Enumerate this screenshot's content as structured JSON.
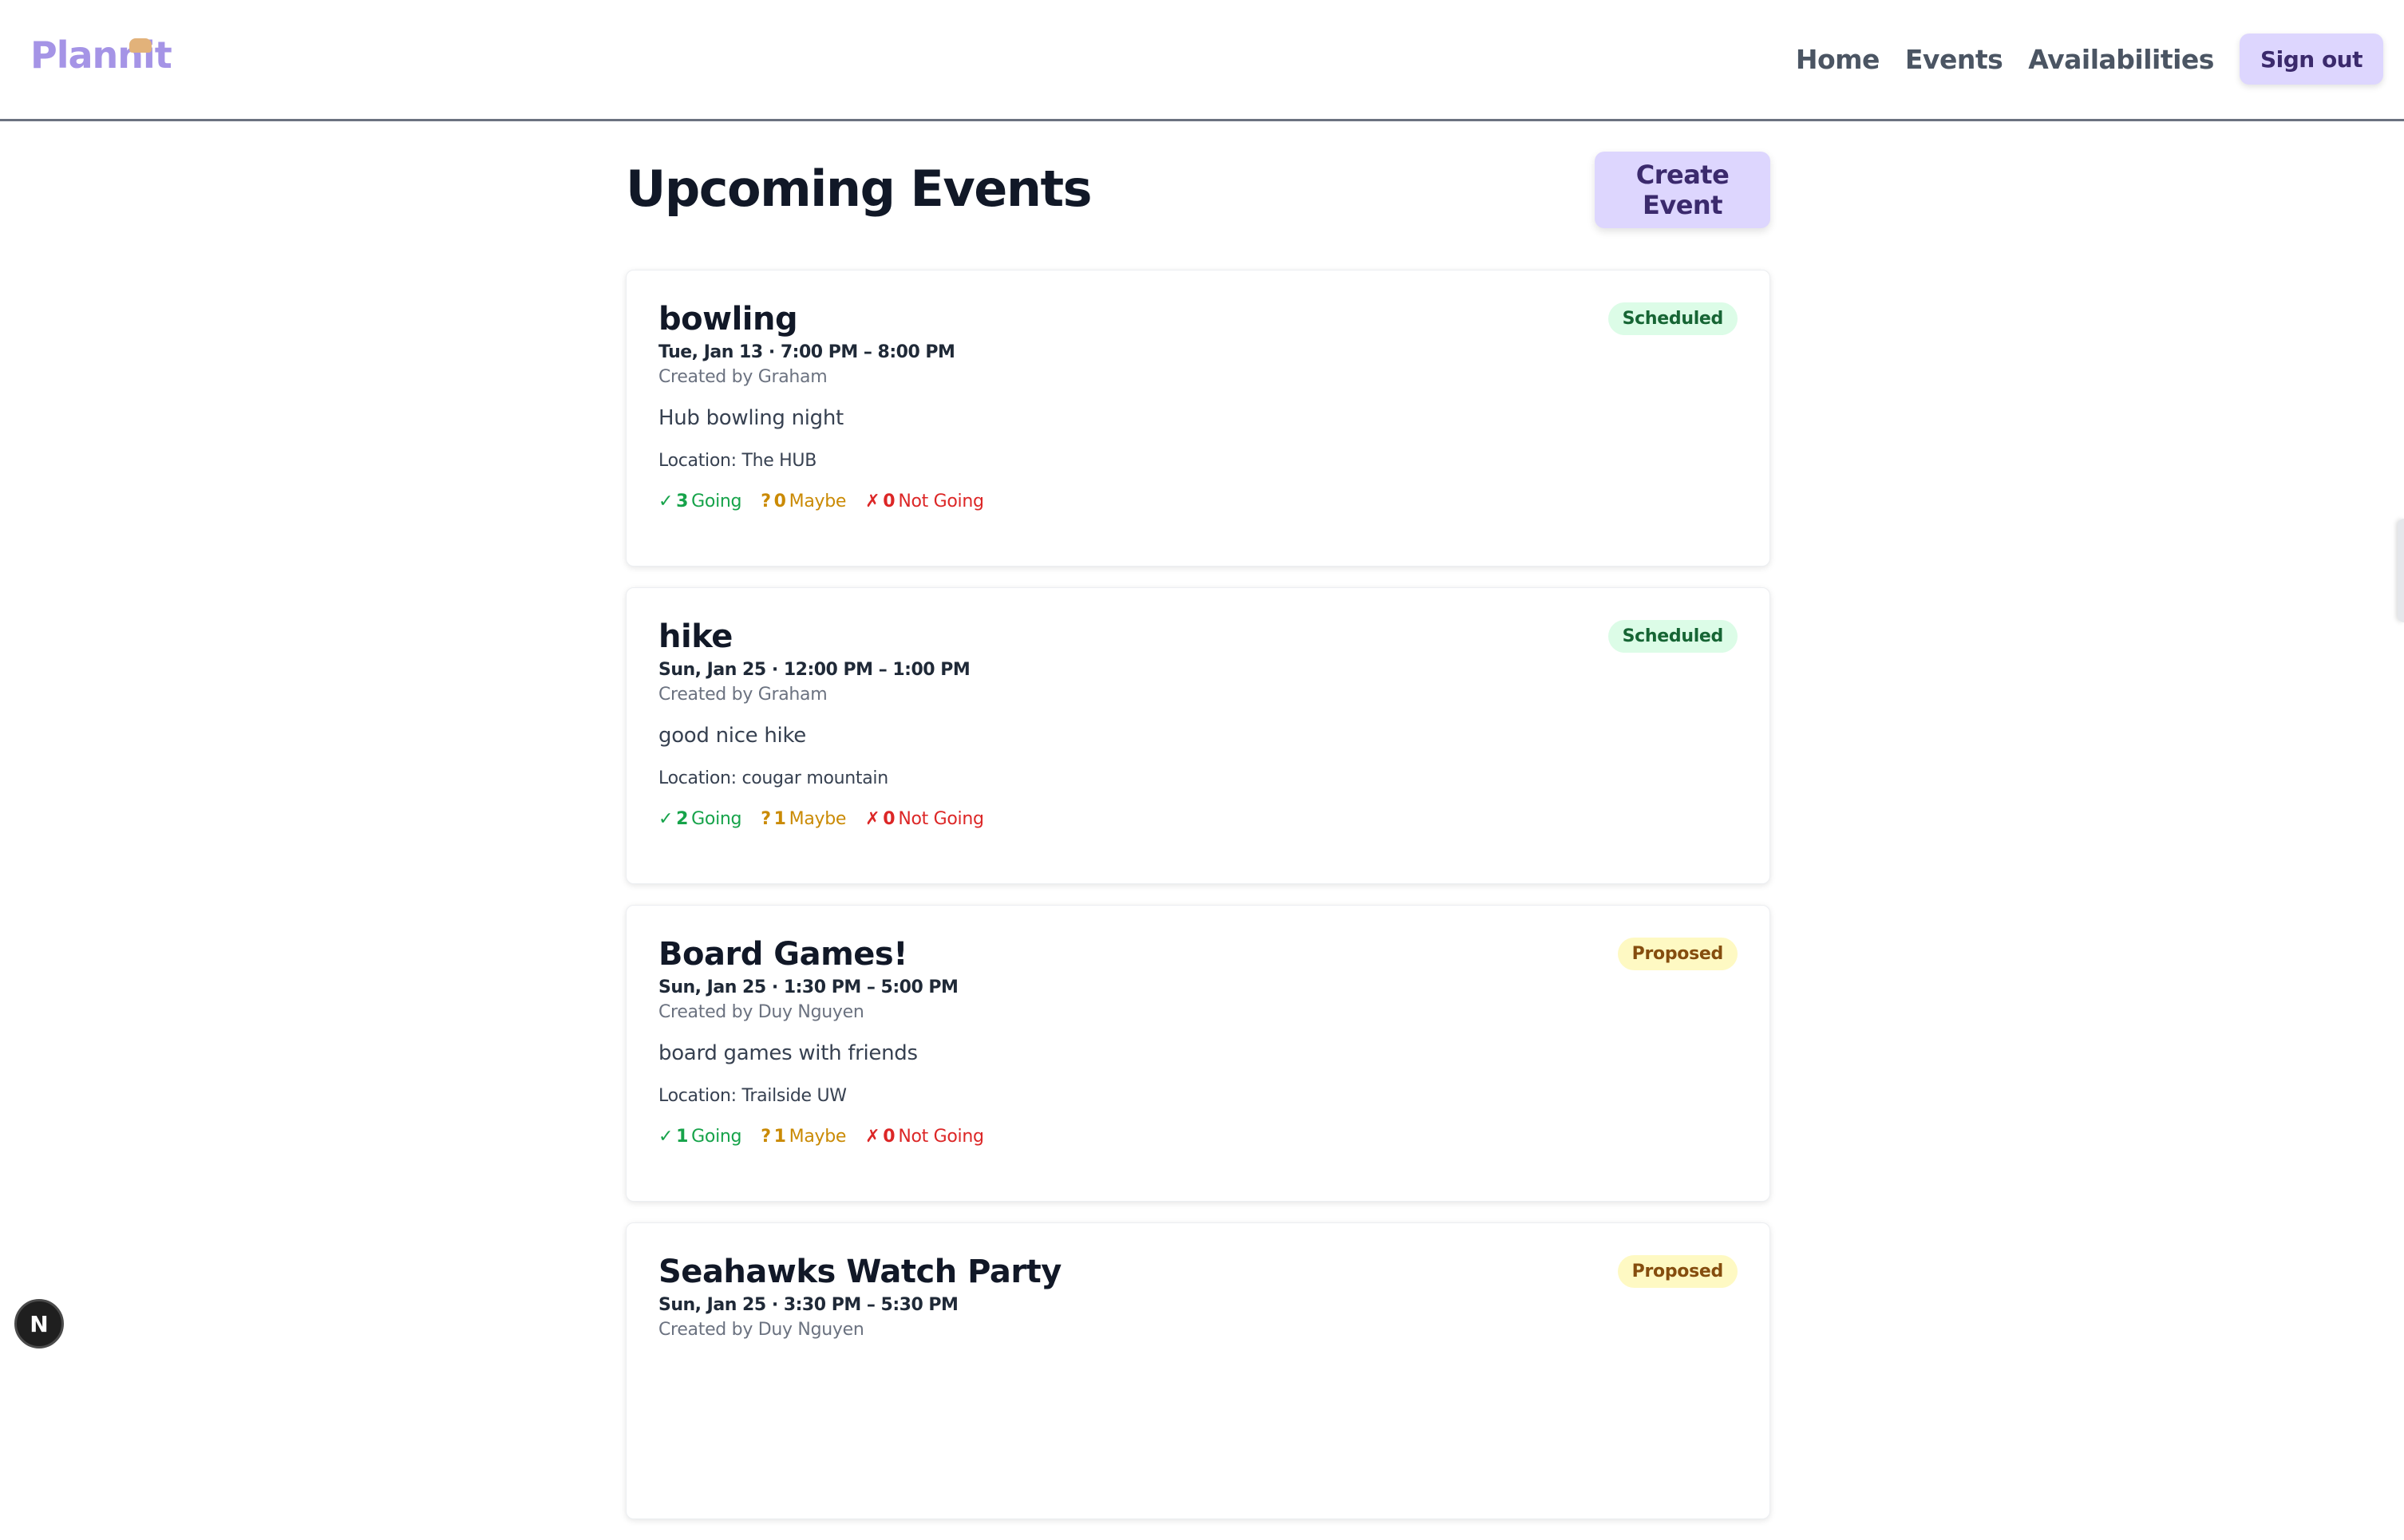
{
  "header": {
    "logo_text": "Plannit",
    "nav": {
      "home": "Home",
      "events": "Events",
      "availabilities": "Availabilities",
      "sign_out": "Sign out"
    }
  },
  "main": {
    "title": "Upcoming Events",
    "create_button": "Create Event",
    "events": [
      {
        "title": "bowling",
        "datetime": "Tue, Jan 13 · 7:00 PM – 8:00 PM",
        "creator": "Created by Graham",
        "description": "Hub bowling night",
        "location": "Location: The HUB",
        "status": "Scheduled",
        "going": {
          "symbol": "✓",
          "count": "3",
          "label": "Going"
        },
        "maybe": {
          "symbol": "?",
          "count": "0",
          "label": "Maybe"
        },
        "not_going": {
          "symbol": "✗",
          "count": "0",
          "label": "Not Going"
        }
      },
      {
        "title": "hike",
        "datetime": "Sun, Jan 25 · 12:00 PM – 1:00 PM",
        "creator": "Created by Graham",
        "description": "good nice hike",
        "location": "Location: cougar mountain",
        "status": "Scheduled",
        "going": {
          "symbol": "✓",
          "count": "2",
          "label": "Going"
        },
        "maybe": {
          "symbol": "?",
          "count": "1",
          "label": "Maybe"
        },
        "not_going": {
          "symbol": "✗",
          "count": "0",
          "label": "Not Going"
        }
      },
      {
        "title": "Board Games!",
        "datetime": "Sun, Jan 25 · 1:30 PM – 5:00 PM",
        "creator": "Created by Duy Nguyen",
        "description": "board games with friends",
        "location": "Location: Trailside UW",
        "status": "Proposed",
        "going": {
          "symbol": "✓",
          "count": "1",
          "label": "Going"
        },
        "maybe": {
          "symbol": "?",
          "count": "1",
          "label": "Maybe"
        },
        "not_going": {
          "symbol": "✗",
          "count": "0",
          "label": "Not Going"
        }
      },
      {
        "title": "Seahawks Watch Party",
        "datetime": "Sun, Jan 25 · 3:30 PM – 5:30 PM",
        "creator": "Created by Duy Nguyen",
        "status": "Proposed"
      }
    ]
  },
  "dev_badge": "N",
  "colors": {
    "brand": "#a594e6",
    "button_bg": "#ddd6fe",
    "going": "#16a34a",
    "maybe": "#ca8a04",
    "not_going": "#dc2626",
    "scheduled_bg": "#dcfce7",
    "proposed_bg": "#fef9c3"
  }
}
